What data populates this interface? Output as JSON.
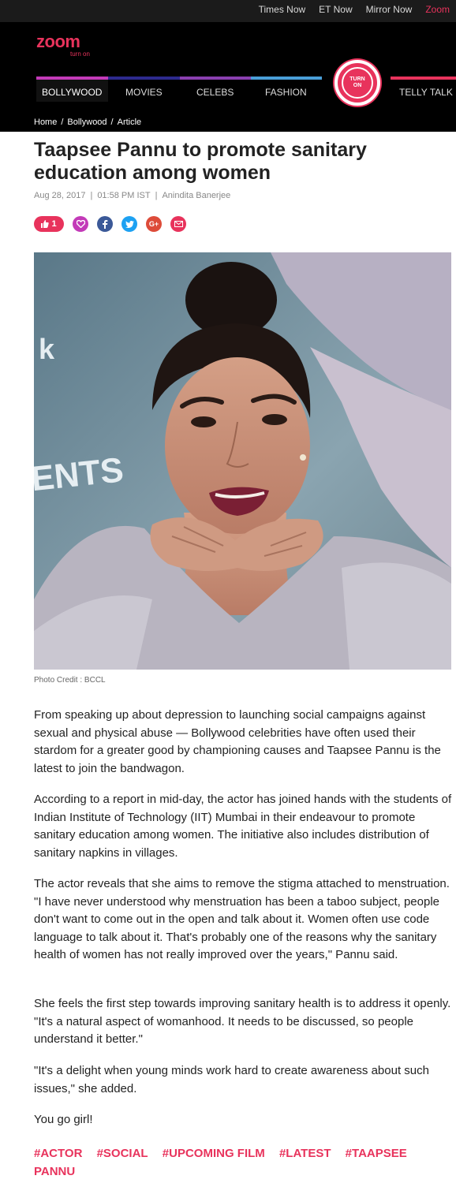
{
  "topbar": {
    "links": [
      "Times Now",
      "ET Now",
      "Mirror Now",
      "Zoom"
    ]
  },
  "header": {
    "logo": "zoom",
    "tagline": "turn on",
    "nav": [
      {
        "label": "BOLLYWOOD",
        "color": "#c33ab8"
      },
      {
        "label": "MOVIES",
        "color": "#2d2a8e"
      },
      {
        "label": "CELEBS",
        "color": "#8a3fb0"
      },
      {
        "label": "FASHION",
        "color": "#4a9fd8"
      },
      {
        "label": "TELLY TALK",
        "color": "#e8335c"
      }
    ],
    "turn_on_label": "TURN ON"
  },
  "breadcrumb": [
    "Home",
    "/",
    "Bollywood",
    "/",
    "Article"
  ],
  "article": {
    "title": "Taapsee Pannu to promote sanitary education among women",
    "date": "Aug 28, 2017",
    "time": "01:58 PM IST",
    "author": "Anindita Banerjee",
    "likes": "1",
    "social_icons": [
      "heart-icon",
      "facebook-icon",
      "twitter-icon",
      "google-plus-icon",
      "email-icon"
    ],
    "photo_credit": "Photo Credit : BCCL",
    "paragraphs": [
      "From speaking up about depression to launching social campaigns against sexual and physical abuse — Bollywood celebrities have often used their stardom for a greater good by championing causes and Taapsee Pannu is the latest to join the bandwagon.",
      "According to a report in mid-day, the actor has joined hands with the students of Indian Institute of Technology (IIT) Mumbai in their endeavour to promote sanitary education among women. The initiative also includes distribution of sanitary napkins in villages.",
      "The actor reveals that she aims to remove the stigma attached to menstruation. \"I have never understood why menstruation has been a taboo subject, people don't want to come out in the open and talk about it. Women often use code language to talk about it. That's probably one of the reasons why the sanitary health of women has not really improved over the years,\" Pannu said.",
      "She feels the first step towards improving sanitary health is to address it openly. \"It's a natural aspect of womanhood. It needs to be discussed, so people understand it better.\"",
      "\"It's a delight when young minds work hard to create awareness about such issues,\" she added.",
      "You go girl!"
    ],
    "tags": [
      "#ACTOR",
      "#SOCIAL",
      "#UPCOMING FILM",
      "#LATEST",
      "#TAAPSEE PANNU"
    ],
    "photo_backdrop_text": [
      "k",
      "ENTS"
    ]
  },
  "colors": {
    "accent": "#e8335c",
    "header_bg": "#000000",
    "facebook": "#3b5998",
    "twitter": "#1da1f2",
    "google": "#dd4b39",
    "heart": "#c33ab8"
  }
}
